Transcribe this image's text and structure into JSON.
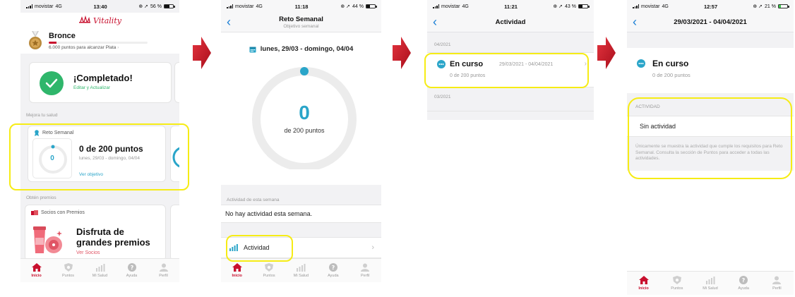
{
  "colors": {
    "brand": "#c8102e",
    "accent": "#2aa5c9",
    "success": "#2fb66b",
    "highlight": "#f6ec15",
    "back": "#1a7fd6"
  },
  "screen1": {
    "status": {
      "carrier": "movistar",
      "network": "4G",
      "time": "13:40",
      "battery": "56 %"
    },
    "logo": "Vitality",
    "tier": {
      "name": "Bronce",
      "next": "6.000 puntos para alcanzar Plata",
      "progress": 0.08
    },
    "completed": {
      "title": "¡Completado!",
      "link": "Editar y Actualizar"
    },
    "health_section": "Mejora tu salud",
    "weekly": {
      "label": "Reto Semanal",
      "points": "0 de 200 puntos",
      "dates": "lunes, 29/03 - domingo, 04/04",
      "ring_value": "0",
      "link": "Ver objetivo",
      "progress": 0
    },
    "rewards_section": "Obtén premios",
    "partners": {
      "label": "Socios con Premios",
      "title": "Disfruta de grandes premios",
      "link": "Ver Socios"
    }
  },
  "screen2": {
    "status": {
      "carrier": "movistar",
      "network": "4G",
      "time": "11:18",
      "battery": "44 %"
    },
    "title": "Reto Semanal",
    "subtitle": "Objetivo semanal",
    "dates": "lunes, 29/03 - domingo, 04/04",
    "ring_value": "0",
    "ring_caption": "de 200 puntos",
    "progress": 0,
    "week_section": "Actividad de esta semana",
    "no_activity": "No hay actividad esta semana.",
    "activity_button": "Actividad"
  },
  "screen3": {
    "status": {
      "carrier": "movistar",
      "network": "4G",
      "time": "11:21",
      "battery": "43 %"
    },
    "title": "Actividad",
    "month1": "04/2021",
    "row_status": "En curso",
    "row_dates": "29/03/2021 - 04/04/2021",
    "row_points": "0 de 200 puntos",
    "month2": "03/2021"
  },
  "screen4": {
    "status": {
      "carrier": "movistar",
      "network": "4G",
      "time": "12:57",
      "battery": "21 %"
    },
    "title": "29/03/2021 - 04/04/2021",
    "status_label": "En curso",
    "points": "0 de 200 puntos",
    "activity_section": "ACTIVIDAD",
    "no_activity": "Sin actividad",
    "note": "Únicamente se muestra la actividad que cumple los requisitos para Reto Semanal. Consulta la sección de Puntos para acceder a todas las actividades."
  },
  "tabs": [
    "Inicio",
    "Puntos",
    "Mi Salud",
    "Ayuda",
    "Perfil"
  ]
}
